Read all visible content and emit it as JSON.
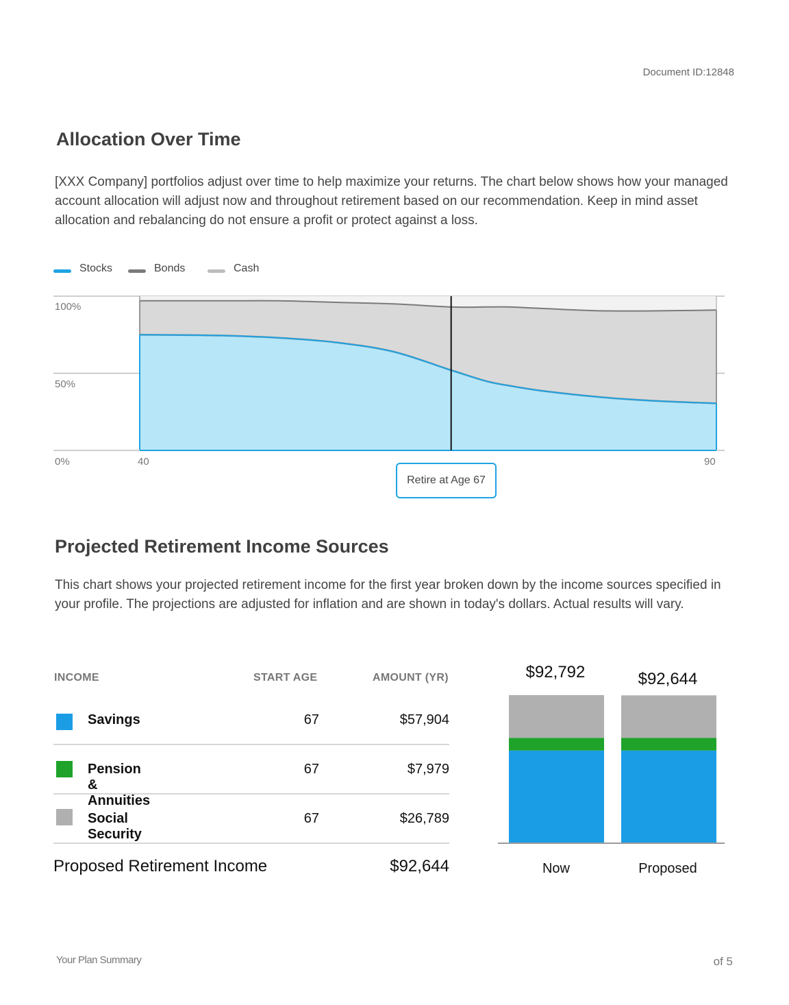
{
  "header": {
    "document_id_label": "Document ID:",
    "document_id_value": "12848"
  },
  "allocation": {
    "title": "Allocation Over Time",
    "description": "[XXX Company] portfolios adjust over time to help maximize your returns. The chart below shows how your managed account allocation will adjust now and throughout retirement based on our recommendation. Keep in mind asset allocation and rebalancing do not ensure a profit or protect against a loss.",
    "retire_label": "Retire at Age 67"
  },
  "income": {
    "title": "Projected Retirement Income Sources",
    "description": "This chart shows your projected retirement income for the first year broken down by the income sources specified in your profile. The projections are adjusted for inflation and are shown in today's dollars. Actual results will vary.",
    "columns": {
      "income": "INCOME",
      "start_age": "START AGE",
      "amount": "AMOUNT (YR)"
    },
    "rows": [
      {
        "name": "Savings",
        "start_age": "67",
        "amount": "$57,904",
        "color": "#1b9de6"
      },
      {
        "name": "Pension & Annuities",
        "start_age": "67",
        "amount": "$7,979",
        "color": "#1fa32a"
      },
      {
        "name": "Social Security",
        "start_age": "67",
        "amount": "$26,789",
        "color": "#b0b0b0"
      }
    ],
    "total_label": "Proposed Retirement Income",
    "total_value": "$92,644"
  },
  "footer": {
    "left": "Your Plan Summary",
    "right": "of 5"
  },
  "chart_data": [
    {
      "type": "area",
      "stacked": true,
      "x_unit": "age",
      "xlim": [
        40,
        90
      ],
      "ylim": [
        0,
        100
      ],
      "y_ticks": [
        "0%",
        "50%",
        "100%"
      ],
      "x_ticks": [
        "40",
        "90"
      ],
      "grid": true,
      "legend_position": "top-left",
      "marker": {
        "x": 67,
        "label": "Retire at Age 67"
      },
      "x": [
        40,
        47,
        52,
        57,
        62,
        67,
        70,
        72,
        75,
        80,
        85,
        90
      ],
      "series": [
        {
          "name": "Stocks",
          "color": "#1fa3e3",
          "fill": "#b7e6f8",
          "values": [
            75,
            74.5,
            73,
            70,
            64,
            52,
            45,
            42,
            38.5,
            34.5,
            32,
            30.5
          ]
        },
        {
          "name": "Bonds",
          "color": "#7a7a7a",
          "fill": "#d9d9d9",
          "values": [
            22,
            22.5,
            24,
            26,
            31,
            41,
            48,
            51,
            53.5,
            56,
            58.5,
            60.5
          ]
        },
        {
          "name": "Cash",
          "color": "#bdbdbd",
          "fill": "#f2f2f2",
          "values": [
            3,
            3,
            3,
            4,
            5,
            7,
            7,
            7,
            8,
            9.5,
            9.5,
            9
          ]
        }
      ]
    },
    {
      "type": "bar",
      "stacked": true,
      "categories": [
        "Now",
        "Proposed"
      ],
      "totals": [
        "$92,792",
        "$92,644"
      ],
      "series": [
        {
          "name": "Savings",
          "color": "#1b9de6",
          "values": [
            57904,
            57904
          ]
        },
        {
          "name": "Pension & Annuities",
          "color": "#1fa32a",
          "values": [
            7979,
            7979
          ]
        },
        {
          "name": "Social Security",
          "color": "#b0b0b0",
          "values": [
            26909,
            26789
          ]
        }
      ],
      "ylim": [
        0,
        92792
      ]
    }
  ]
}
